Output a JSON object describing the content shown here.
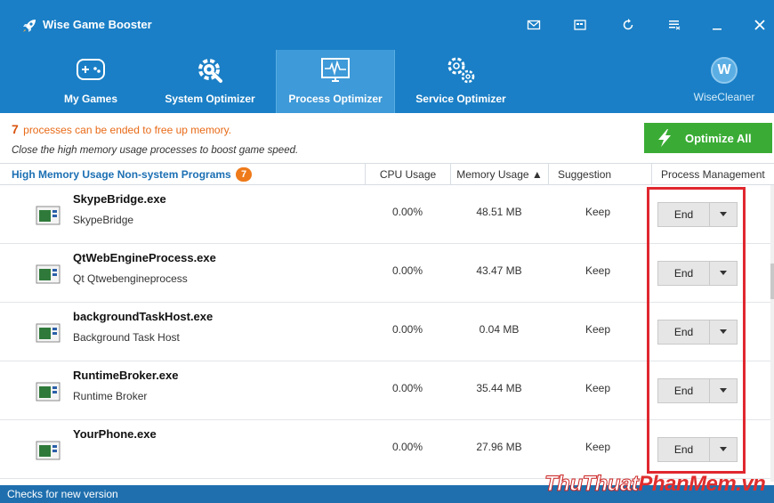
{
  "app": {
    "title": "Wise Game Booster"
  },
  "tabs": [
    {
      "label": "My Games"
    },
    {
      "label": "System Optimizer"
    },
    {
      "label": "Process Optimizer"
    },
    {
      "label": "Service Optimizer"
    }
  ],
  "brand": {
    "logo_letter": "W",
    "label": "WiseCleaner"
  },
  "info": {
    "count": "7",
    "line1": "processes can be ended to free up memory.",
    "line2": "Close the high memory usage processes to boost game speed."
  },
  "optimize_button": "Optimize All",
  "table": {
    "title": "High Memory Usage Non-system Programs",
    "badge": "7",
    "columns": [
      "CPU Usage",
      "Memory Usage ▲",
      "Suggestion",
      "Process Management"
    ],
    "rows": [
      {
        "name": "SkypeBridge.exe",
        "desc": "SkypeBridge",
        "cpu": "0.00%",
        "mem": "48.51 MB",
        "suggestion": "Keep",
        "action": "End"
      },
      {
        "name": "QtWebEngineProcess.exe",
        "desc": "Qt Qtwebengineprocess",
        "cpu": "0.00%",
        "mem": "43.47 MB",
        "suggestion": "Keep",
        "action": "End"
      },
      {
        "name": "backgroundTaskHost.exe",
        "desc": "Background Task Host",
        "cpu": "0.00%",
        "mem": "0.04 MB",
        "suggestion": "Keep",
        "action": "End"
      },
      {
        "name": "RuntimeBroker.exe",
        "desc": "Runtime Broker",
        "cpu": "0.00%",
        "mem": "35.44 MB",
        "suggestion": "Keep",
        "action": "End"
      },
      {
        "name": "YourPhone.exe",
        "desc": "",
        "cpu": "0.00%",
        "mem": "27.96 MB",
        "suggestion": "Keep",
        "action": "End"
      }
    ]
  },
  "status": {
    "text": "Checks for new version"
  },
  "watermark": {
    "part1": "ThuThuat",
    "part2": "PhanMem.vn"
  },
  "colors": {
    "header": "#1a7fc6",
    "active_tab": "#3e9ad8",
    "optimize": "#3aac35",
    "accent_orange": "#ee7a1a",
    "highlight": "#e0272f"
  }
}
